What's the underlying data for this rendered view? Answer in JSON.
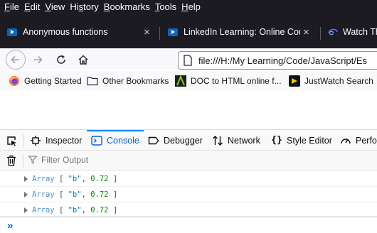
{
  "menu": [
    {
      "pre": "",
      "key": "F",
      "post": "ile"
    },
    {
      "pre": "",
      "key": "E",
      "post": "dit"
    },
    {
      "pre": "",
      "key": "V",
      "post": "iew"
    },
    {
      "pre": "Hi",
      "key": "s",
      "post": "tory"
    },
    {
      "pre": "",
      "key": "B",
      "post": "ookmarks"
    },
    {
      "pre": "",
      "key": "T",
      "post": "ools"
    },
    {
      "pre": "",
      "key": "H",
      "post": "elp"
    }
  ],
  "tabs": [
    {
      "title": "Anonymous functions",
      "icon": "linkedin-learning-icon",
      "close": "×"
    },
    {
      "title": "LinkedIn Learning: Online Cour",
      "icon": "linkedin-learning-icon",
      "close": "×"
    },
    {
      "title": "Watch Th",
      "icon": "disney-plus-icon"
    }
  ],
  "urlbar": {
    "url": "file:///H:/My Learning/Code/JavaScript/Es"
  },
  "bookmarks": [
    {
      "label": "Getting Started",
      "icon": "firefox-icon"
    },
    {
      "label": "Other Bookmarks",
      "icon": "folder-icon"
    },
    {
      "label": "DOC to HTML online f...",
      "icon": "doc-to-html-icon"
    },
    {
      "label": "JustWatch Search",
      "icon": "justwatch-icon"
    }
  ],
  "devtools": {
    "tabs": [
      {
        "label": "Inspector",
        "icon": "inspector-icon"
      },
      {
        "label": "Console",
        "icon": "console-icon",
        "selected": true
      },
      {
        "label": "Debugger",
        "icon": "debugger-icon"
      },
      {
        "label": "Network",
        "icon": "network-icon"
      },
      {
        "label": "Style Editor",
        "icon": "style-editor-icon"
      },
      {
        "label": "Perfo",
        "icon": "performance-icon"
      }
    ],
    "filter_placeholder": "Filter Output"
  },
  "console": {
    "rows": [
      {
        "type": "Array",
        "open": "[",
        "str": "\"b\"",
        "comma": ",",
        "num": "0.72",
        "close": "]"
      },
      {
        "type": "Array",
        "open": "[",
        "str": "\"b\"",
        "comma": ",",
        "num": "0.72",
        "close": "]"
      },
      {
        "type": "Array",
        "open": "[",
        "str": "\"b\"",
        "comma": ",",
        "num": "0.72",
        "close": "]"
      }
    ],
    "prompt": "»"
  },
  "colors": {
    "chrome_dark": "#1c1b22",
    "accent": "#0a84ff",
    "selected_text": "#0060df"
  }
}
